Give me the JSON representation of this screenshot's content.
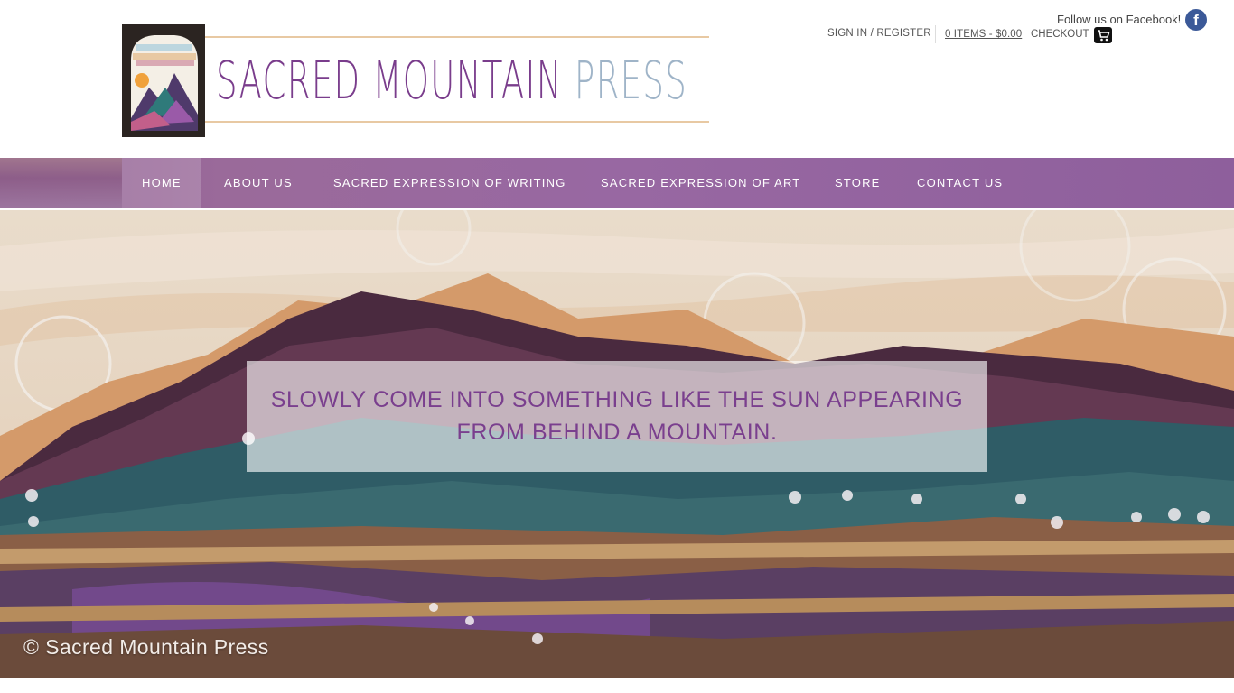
{
  "header": {
    "logo": {
      "title_main": "SACRED MOUNTAIN",
      "title_press": "PRESS",
      "colors": {
        "main": "#7a3d8c",
        "press": "#9fb4c8",
        "rule": "#e8c9a3"
      }
    },
    "social": {
      "label": "Follow us on Facebook!",
      "icon": "facebook-icon",
      "color": "#3b5998"
    },
    "account": {
      "signin_label": "SIGN IN / REGISTER"
    },
    "cart": {
      "summary": "0 ITEMS - $0.00",
      "checkout_label": "CHECKOUT",
      "icon": "shopping-cart-icon"
    }
  },
  "nav": {
    "items": [
      {
        "label": "HOME",
        "active": true
      },
      {
        "label": "ABOUT US",
        "active": false
      },
      {
        "label": "SACRED EXPRESSION OF WRITING",
        "active": false
      },
      {
        "label": "SACRED EXPRESSION OF ART",
        "active": false
      },
      {
        "label": "STORE",
        "active": false
      },
      {
        "label": "CONTACT US",
        "active": false
      }
    ],
    "background_color": "#9868a2"
  },
  "hero": {
    "quote": "SLOWLY COME INTO SOMETHING LIKE THE SUN APPEARING FROM BEHIND A MOUNTAIN.",
    "copyright": "© Sacred Mountain Press",
    "quote_color": "#7a3f8e"
  }
}
